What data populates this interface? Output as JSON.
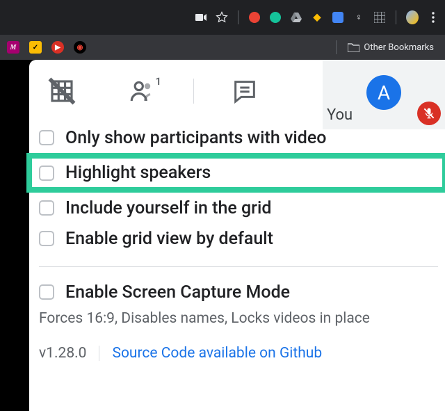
{
  "chrome": {
    "other_bookmarks_label": "Other Bookmarks"
  },
  "self_view": {
    "initial": "A",
    "you_label": "You"
  },
  "options": {
    "only_video": "Only show participants with video",
    "highlight_speakers": "Highlight speakers",
    "include_yourself": "Include yourself in the grid",
    "enable_default": "Enable grid view by default",
    "screen_capture": "Enable Screen Capture Mode",
    "screen_capture_sub": "Forces 16:9, Disables names, Locks videos in place"
  },
  "footer": {
    "version": "v1.28.0",
    "source_link": "Source Code available on Github"
  }
}
